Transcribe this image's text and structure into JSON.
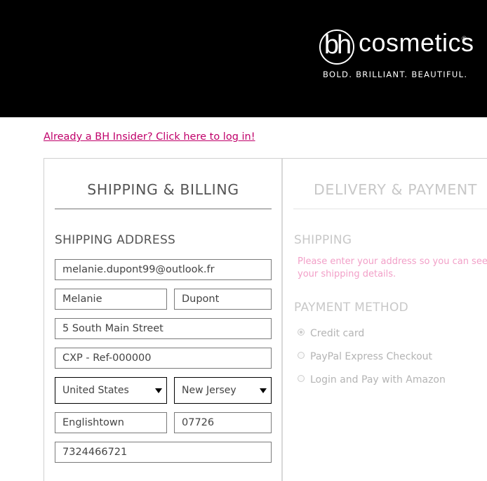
{
  "header": {
    "logo_mark": "bh",
    "logo_word": "cosmetics",
    "logo_reg": "®",
    "tagline": "BOLD. BRILLIANT. BEAUTIFUL."
  },
  "login_link": "Already a BH Insider? Click here to log in!",
  "shipping_billing": {
    "title": "SHIPPING & BILLING",
    "section_title": "SHIPPING ADDRESS",
    "email": "melanie.dupont99@outlook.fr",
    "first_name": "Melanie",
    "last_name": "Dupont",
    "address1": "5 South Main Street",
    "address2": "CXP - Ref-000000",
    "country": "United States",
    "state": "New Jersey",
    "city": "Englishtown",
    "zip": "07726",
    "phone": "7324466721"
  },
  "delivery_payment": {
    "title": "DELIVERY & PAYMENT",
    "shipping_title": "SHIPPING",
    "shipping_note_line1": "Please enter your address so you can see",
    "shipping_note_line2": "your shipping details.",
    "payment_title": "PAYMENT METHOD",
    "payment_options": [
      {
        "label": "Credit card",
        "selected": true
      },
      {
        "label": "PayPal Express Checkout",
        "selected": false
      },
      {
        "label": "Login and Pay with Amazon",
        "selected": false
      }
    ]
  },
  "colors": {
    "header_bg": "#000000",
    "link": "#c0006a",
    "note_pink": "#f2a0c8"
  }
}
